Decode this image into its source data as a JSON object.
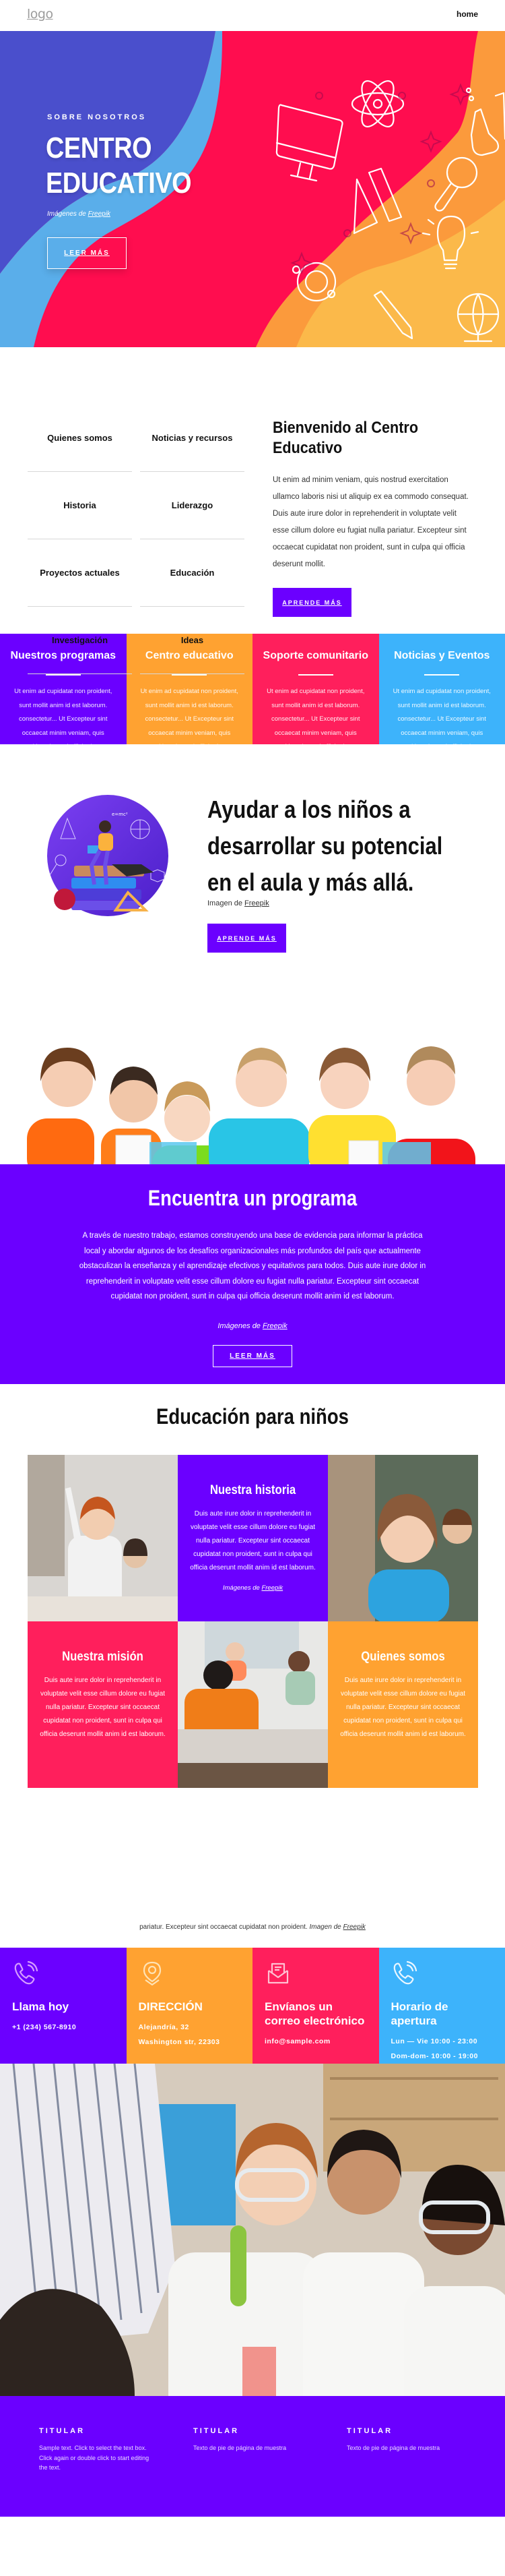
{
  "header": {
    "logo_text": "logo",
    "nav": [
      {
        "label": "home"
      }
    ]
  },
  "colors": {
    "purple": "#6b00ff",
    "orange": "#ffa231",
    "pink": "#ff1f5c",
    "blue": "#3db3fb",
    "hero_red": "#ff0d4f",
    "hero_indigo": "#4a4fcc",
    "hero_sky": "#5aaeea",
    "hero_yellow": "#fbb94a"
  },
  "hero": {
    "eyebrow": "SOBRE NOSOTROS",
    "title_line1": "CENTRO",
    "title_line2": "EDUCATIVO",
    "credit_prefix": "Imágenes de ",
    "credit_link": "Freepik",
    "button_label": "LEER MÁS",
    "icons": [
      "computer-monitor-icon",
      "atom-icon",
      "flask-icon",
      "test-tube-icon",
      "magnifier-icon",
      "ruler-triangle-icon",
      "lightbulb-icon",
      "solar-system-icon",
      "pencil-icon",
      "globe-icon"
    ]
  },
  "intro": {
    "menu": [
      {
        "label": "Quienes somos"
      },
      {
        "label": "Noticias y recursos"
      },
      {
        "label": "Historia"
      },
      {
        "label": "Liderazgo"
      },
      {
        "label": "Proyectos actuales"
      },
      {
        "label": "Educación"
      },
      {
        "label": "Investigación"
      },
      {
        "label": "Ideas"
      }
    ],
    "title": "Bienvenido al Centro Educativo",
    "body": "Ut enim ad minim veniam, quis nostrud exercitation ullamco laboris nisi ut aliquip ex ea commodo consequat. Duis aute irure dolor in reprehenderit in voluptate velit esse cillum dolore eu fugiat nulla pariatur. Excepteur sint occaecat cupidatat non proident, sunt in culpa qui officia deserunt mollit.",
    "button_label": "APRENDE MÁS"
  },
  "features": [
    {
      "title": "Nuestros programas",
      "body": "Ut enim ad cupidatat non proident, sunt mollit anim id est laborum. consectetur... Ut Excepteur sint occaecat minim veniam, quis nostrud in culpa qui officia deserunt"
    },
    {
      "title": "Centro educativo",
      "body": "Ut enim ad cupidatat non proident, sunt mollit anim id est laborum. consectetur... Ut Excepteur sint occaecat minim veniam, quis nostrud in culpa qui officia deserunt"
    },
    {
      "title": "Soporte comunitario",
      "body": "Ut enim ad cupidatat non proident, sunt mollit anim id est laborum. consectetur... Ut Excepteur sint occaecat minim veniam, quis nostrud in culpa qui officia deserunt"
    },
    {
      "title": "Noticias y Eventos",
      "body": "Ut enim ad cupidatat non proident, sunt mollit anim id est laborum. consectetur... Ut Excepteur sint occaecat minim veniam, quis nostrud in culpa qui officia deserunt"
    }
  ],
  "ayudar": {
    "title": "Ayudar a los niños a desarrollar su potencial en el aula y más allá.",
    "credit_prefix": "Imagen de ",
    "credit_link": "Freepik",
    "button_label": "APRENDE MÁS",
    "illustration_formula": "e=mc²"
  },
  "programa": {
    "title": "Encuentra un programa",
    "body": "A través de nuestro trabajo, estamos construyendo una base de evidencia para informar la práctica local y abordar algunos de los desafíos organizacionales más profundos del país que actualmente obstaculizan la enseñanza y el aprendizaje efectivos y equitativos para todos. Duis aute irure dolor in reprehenderit in voluptate velit esse cillum dolore eu fugiat nulla pariatur. Excepteur sint occaecat cupidatat non proident, sunt in culpa qui officia deserunt mollit anim id est laborum.",
    "credit_prefix": "Imágenes de ",
    "credit_link": "Freepik",
    "button_label": "LEER MÁS"
  },
  "educacion": {
    "title": "Educación para niños",
    "historia": {
      "title": "Nuestra historia",
      "body": "Duis aute irure dolor in reprehenderit in voluptate velit esse cillum dolore eu fugiat nulla pariatur. Excepteur sint occaecat cupidatat non proident, sunt in culpa qui officia deserunt mollit anim id est laborum.",
      "credit_prefix": "Imágenes de ",
      "credit_link": "Freepik"
    },
    "mision": {
      "title": "Nuestra misión",
      "body": "Duis aute irure dolor in reprehenderit in voluptate velit esse cillum dolore eu fugiat nulla pariatur. Excepteur sint occaecat cupidatat non proident, sunt in culpa qui officia deserunt mollit anim id est laborum."
    },
    "quienes": {
      "title": "Quienes somos",
      "body": "Duis aute irure dolor in reprehenderit in voluptate velit esse cillum dolore eu fugiat nulla pariatur. Excepteur sint occaecat cupidatat non proident, sunt in culpa qui officia deserunt mollit anim id est laborum."
    },
    "caption_text": "pariatur. Excepteur sint occaecat cupidatat non proident. ",
    "caption_credit_prefix": "Imagen de ",
    "caption_credit_link": "Freepik"
  },
  "contact": [
    {
      "icon": "phone-icon",
      "title": "Llama hoy",
      "lines": [
        "+1 (234) 567-8910"
      ]
    },
    {
      "icon": "location-pin-icon",
      "title": "DIRECCIÓN",
      "lines": [
        "Alejandría, 32",
        "Washington str, 22303"
      ]
    },
    {
      "icon": "mail-icon",
      "title": "Envíanos un correo electrónico",
      "lines": [
        "info@sample.com"
      ]
    },
    {
      "icon": "phone-icon",
      "title": "Horario de apertura",
      "lines": [
        "Lun — Vie 10:00 - 23:00",
        "Dom-dom- 10:00 - 19:00"
      ]
    }
  ],
  "footer": {
    "columns": [
      {
        "title": "TITULAR",
        "body": "Sample text. Click to select the text box. Click again or double click to start editing the text."
      },
      {
        "title": "TITULAR",
        "body": "Texto de pie de página de muestra"
      },
      {
        "title": "TITULAR",
        "body": "Texto de pie de página de muestra"
      }
    ]
  }
}
